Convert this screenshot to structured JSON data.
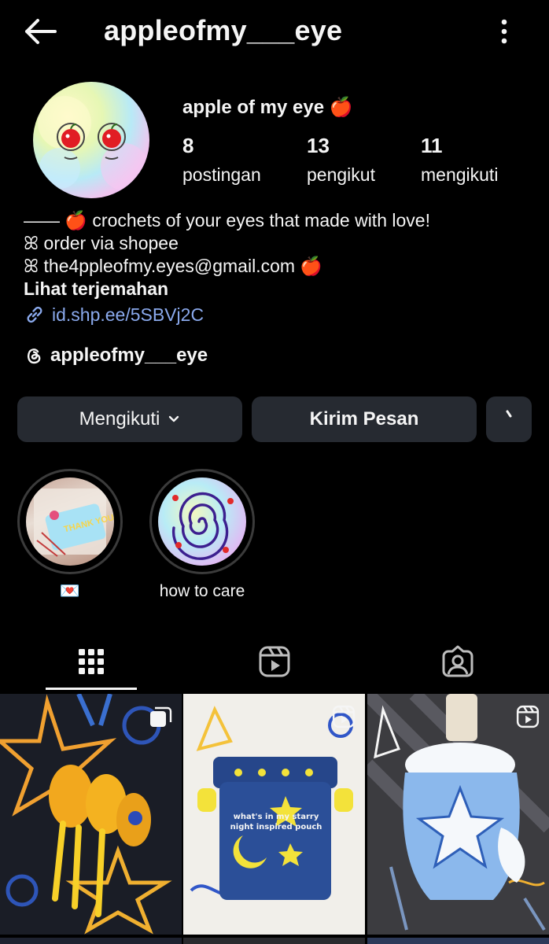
{
  "header": {
    "username": "appleofmy___eye"
  },
  "profile": {
    "display_name": "apple of my eye 🍎",
    "stats": [
      {
        "value": "8",
        "label": "postingan"
      },
      {
        "value": "13",
        "label": "pengikut"
      },
      {
        "value": "11",
        "label": "mengikuti"
      }
    ],
    "bio_lines": [
      "—— 🍎 crochets of your eyes that made with love!",
      "ꕤ order via shopee",
      "ꕤ the4ppleofmy.eyes@gmail.com 🍎"
    ],
    "translate_label": "Lihat terjemahan",
    "link": "id.shp.ee/5SBVj2C",
    "threads_handle": "appleofmy___eye"
  },
  "actions": {
    "follow_label": "Mengikuti",
    "message_label": "Kirim Pesan"
  },
  "highlights": [
    {
      "label": "💌"
    },
    {
      "label": "how to care"
    }
  ],
  "tabs": [
    "grid",
    "reels",
    "tagged"
  ],
  "active_tab": "grid",
  "grid": [
    {
      "type": "carousel"
    },
    {
      "type": "reel",
      "caption": "what's in my starry night inspired pouch"
    },
    {
      "type": "reel"
    }
  ],
  "colors": {
    "background": "#000000",
    "button": "#262a31",
    "link": "#8aa9ec",
    "text": "#f5f5f5"
  }
}
